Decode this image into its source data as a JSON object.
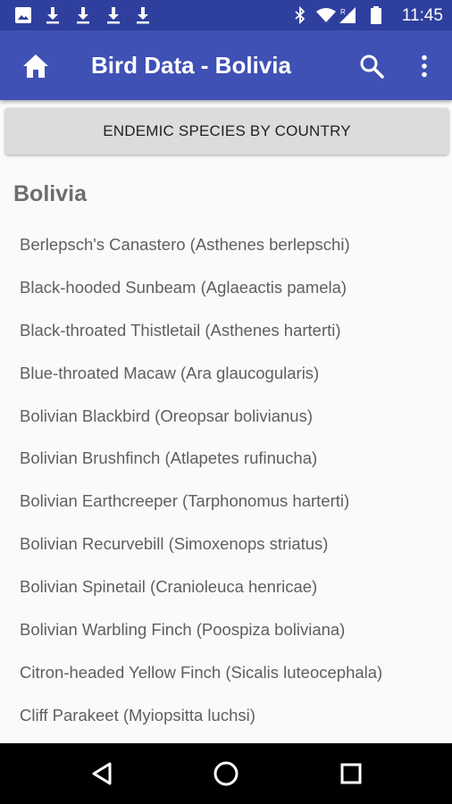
{
  "status_bar": {
    "time": "11:45",
    "left_icons": [
      "image-icon",
      "download-icon",
      "download-icon",
      "download-icon",
      "download-icon"
    ],
    "right_icons": [
      "bluetooth-icon",
      "wifi-icon",
      "signal-icon",
      "battery-icon"
    ]
  },
  "app_bar": {
    "title": "Bird Data - Bolivia",
    "home_icon": "home-icon",
    "search_icon": "search-icon",
    "menu_icon": "more-vert-icon"
  },
  "category_button": {
    "label": "ENDEMIC SPECIES BY COUNTRY"
  },
  "country_heading": "Bolivia",
  "species": [
    "Berlepsch's Canastero (Asthenes berlepschi)",
    "Black-hooded Sunbeam (Aglaeactis pamela)",
    "Black-throated Thistletail (Asthenes harterti)",
    "Blue-throated Macaw (Ara glaucogularis)",
    "Bolivian Blackbird (Oreopsar bolivianus)",
    "Bolivian Brushfinch (Atlapetes rufinucha)",
    "Bolivian Earthcreeper (Tarphonomus harterti)",
    "Bolivian Recurvebill (Simoxenops striatus)",
    "Bolivian Spinetail (Cranioleuca henricae)",
    "Bolivian Warbling Finch (Poospiza boliviana)",
    "Citron-headed Yellow Finch (Sicalis luteocephala)",
    "Cliff Parakeet (Myiopsitta luchsi)"
  ],
  "nav_bar": {
    "back_icon": "back-icon",
    "home_icon": "home-circle-icon",
    "recents_icon": "recents-icon"
  }
}
